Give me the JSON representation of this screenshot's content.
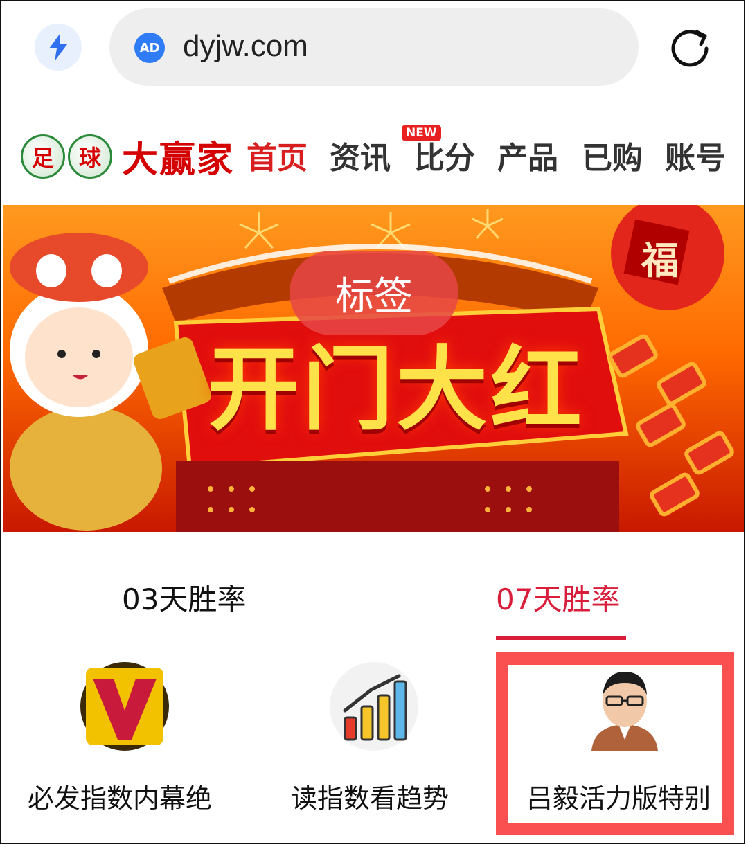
{
  "browser": {
    "url": "dyjw.com",
    "ad_badge": "AD",
    "bolt_icon": "bolt-icon",
    "reload_icon": "reload-icon"
  },
  "site": {
    "logo_ball_text": [
      "足",
      "球"
    ],
    "logo_text": "大赢家",
    "nav": [
      {
        "label": "首页",
        "active": true
      },
      {
        "label": "资讯"
      },
      {
        "label": "比分",
        "badge": "NEW"
      },
      {
        "label": "产品"
      },
      {
        "label": "已购"
      },
      {
        "label": "账号"
      }
    ]
  },
  "banner": {
    "tag": "标签",
    "title": "开门大红",
    "fu_char": "福"
  },
  "tabs": [
    {
      "label": "03天胜率",
      "active": false
    },
    {
      "label": "07天胜率",
      "active": true
    }
  ],
  "cards": [
    {
      "label": "必发指数内幕绝",
      "icon": "v-logo-icon"
    },
    {
      "label": "读指数看趋势",
      "icon": "bar-chart-icon"
    },
    {
      "label": "吕毅活力版特别",
      "icon": "avatar-photo"
    }
  ],
  "colors": {
    "accent": "#d81e3a",
    "brand_red": "#d40000",
    "highlight": "#fa5050"
  }
}
